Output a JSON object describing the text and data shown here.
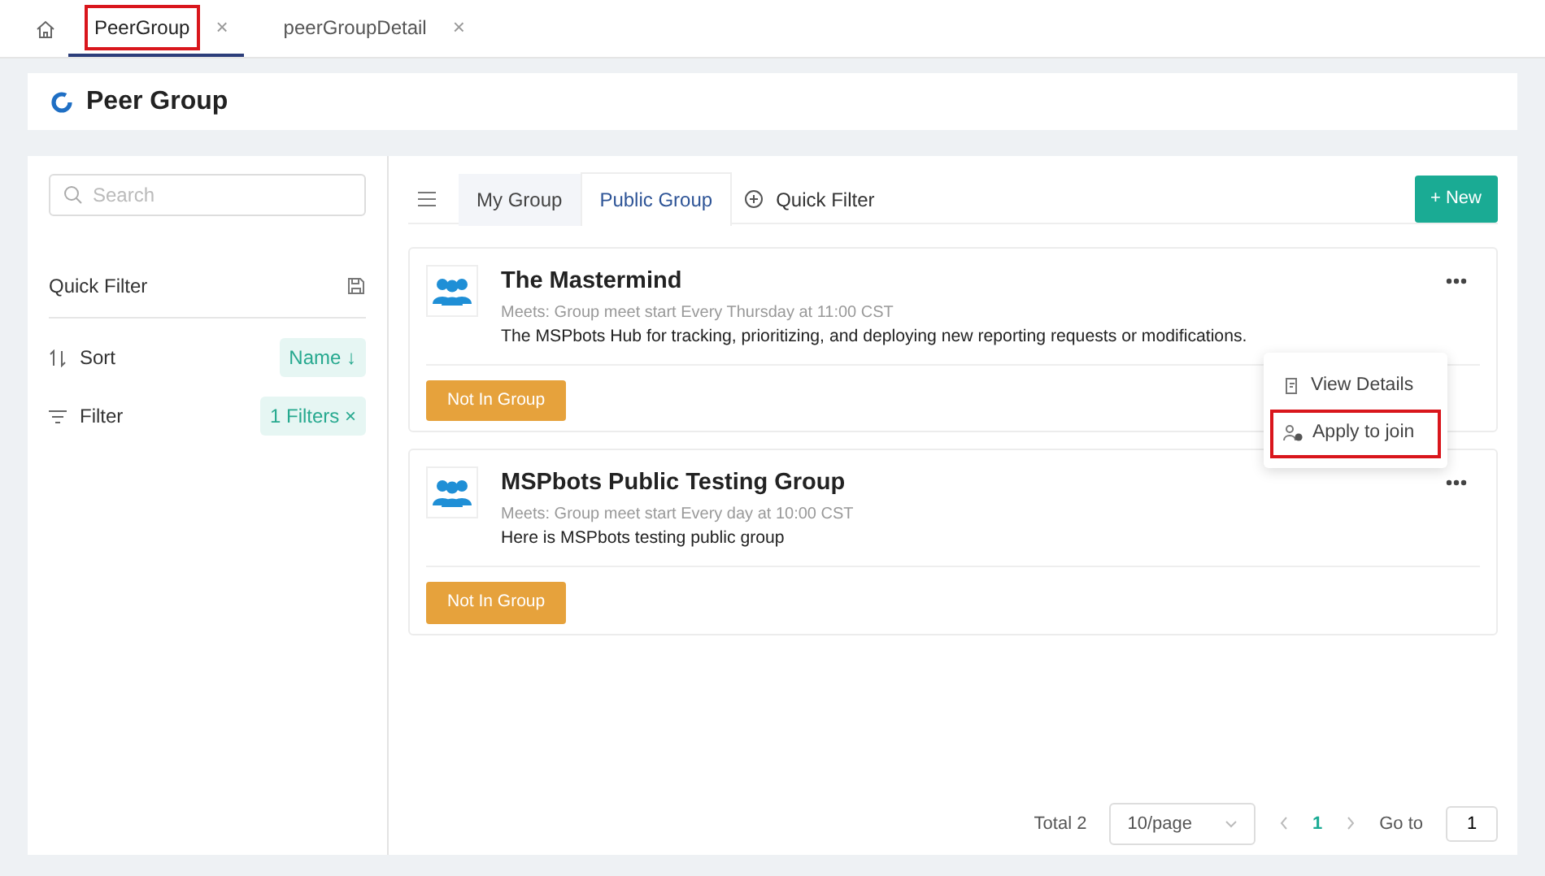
{
  "page_tabs": [
    {
      "label": "PeerGroup",
      "selected": true,
      "highlighted": true,
      "close": "×"
    },
    {
      "label": "peerGroupDetail",
      "selected": false,
      "highlighted": false,
      "close": "×"
    }
  ],
  "page_title": "Peer Group",
  "sidebar": {
    "search": {
      "placeholder": "Search"
    },
    "quick_filter": "Quick Filter",
    "sort": {
      "label": "Sort",
      "value": "Name ↓"
    },
    "filter": {
      "label": "Filter",
      "value": "1 Filters ×"
    }
  },
  "tabs": [
    {
      "label": "My Group",
      "selected": false
    },
    {
      "label": "Public Group",
      "selected": true
    }
  ],
  "quick_filter": "Quick Filter",
  "new_button": "+ New",
  "groups": [
    {
      "name": "The Mastermind",
      "meets": "Meets: Group meet start Every Thursday at 11:00 CST",
      "description": "The MSPbots Hub for tracking, prioritizing, and deploying new reporting requests or modifications.",
      "status": "Not In Group",
      "menu_open": true
    },
    {
      "name": "MSPbots Public Testing Group",
      "meets": "Meets: Group meet start Every day at 10:00 CST",
      "description": "Here is MSPbots testing public group",
      "status": "Not In Group",
      "menu_open": false
    }
  ],
  "menu": [
    {
      "label": "View Details",
      "highlighted": false
    },
    {
      "label": "Apply to join",
      "highlighted": true
    }
  ],
  "pagination": {
    "total": "Total 2",
    "page_size": "10/page",
    "current_page": "1",
    "goto_label": "Go to",
    "goto_value": "1"
  }
}
